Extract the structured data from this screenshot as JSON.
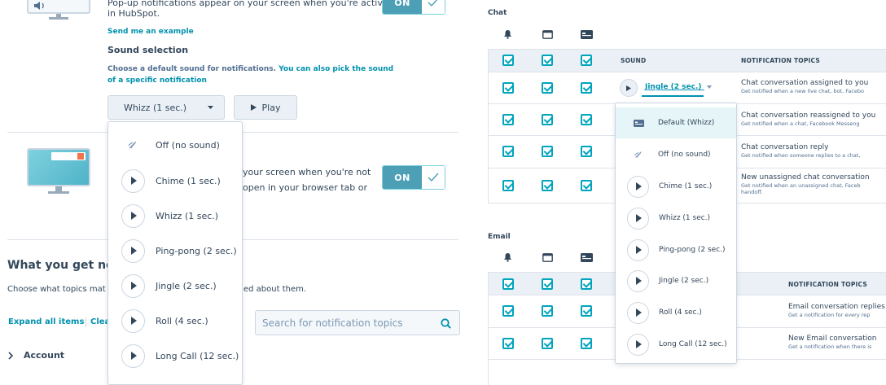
{
  "left": {
    "popup_desc_line1": "Pop-up notifications appear on your screen when you're active",
    "popup_desc_line2": "in HubSpot.",
    "send_example": "Send me an example",
    "toggle_on_label": "ON",
    "sound_selection_title": "Sound selection",
    "sound_help_line1_a": "Choose a default sound for notifications.",
    "sound_help_line1_b": "You can also pick the sound",
    "sound_help_line2": "of a specific notification",
    "sound_select_value": "Whizz (1 sec.)",
    "play_label": "Play",
    "browser_desc_line1": "your screen when you're not",
    "browser_desc_line2": "open in your browser tab or",
    "dropdown_options": [
      {
        "label": "Off (no sound)",
        "icon": "mute-icon"
      },
      {
        "label": "Chime (1 sec.)",
        "icon": "play-icon"
      },
      {
        "label": "Whizz (1 sec.)",
        "icon": "play-icon"
      },
      {
        "label": "Ping-pong (2 sec.)",
        "icon": "play-icon"
      },
      {
        "label": "Jingle (2 sec.)",
        "icon": "play-icon"
      },
      {
        "label": "Roll (4 sec.)",
        "icon": "play-icon"
      },
      {
        "label": "Long Call (12 sec.)",
        "icon": "play-icon"
      }
    ],
    "what_you_get": "What you get no",
    "choose_topics_a": "Choose what topics mat",
    "choose_topics_b": "ed about them.",
    "expand_all": "Expand all items",
    "clear": "Clea",
    "search_placeholder": "Search for notification topics",
    "account": "Account"
  },
  "right": {
    "chat_title": "Chat",
    "email_title": "Email",
    "col_sound": "SOUND",
    "col_topics": "NOTIFICATION TOPICS",
    "jingle_value": "Jingle (2 sec.)",
    "chat_topics": [
      {
        "title": "Chat conversation assigned to you",
        "sub": "Get notified when a new live chat, bot, Facebo"
      },
      {
        "title": "Chat conversation reassigned to you",
        "sub": "Get notified when a chat, Facebook Messeng"
      },
      {
        "title": "Chat conversation reply",
        "sub": "Get notified when someone replies to a chat,"
      },
      {
        "title": "New unassigned chat conversation",
        "sub": "Get notified when an unassigned chat, Faceb",
        "sub2": "handoff."
      }
    ],
    "email_topics": [
      {
        "title": "Email conversation replies",
        "sub": "Get a notification for every rep"
      },
      {
        "title": "New Email conversation",
        "sub": "Get a notification when there is"
      }
    ],
    "dropdown_options": [
      {
        "label": "Default (Whizz)",
        "icon": "default-sound-icon"
      },
      {
        "label": "Off (no sound)",
        "icon": "mute-icon"
      },
      {
        "label": "Chime (1 sec.)",
        "icon": "play-icon"
      },
      {
        "label": "Whizz (1 sec.)",
        "icon": "play-icon"
      },
      {
        "label": "Ping-pong (2 sec.)",
        "icon": "play-icon"
      },
      {
        "label": "Jingle (2 sec.)",
        "icon": "play-icon"
      },
      {
        "label": "Roll (4 sec.)",
        "icon": "play-icon"
      },
      {
        "label": "Long Call (12 sec.)",
        "icon": "play-icon"
      }
    ]
  },
  "colors": {
    "accent": "#00a4bd",
    "toggle_on": "#4d9fb6",
    "link": "#0091ae",
    "text": "#33475b",
    "border": "#cbd6e2",
    "header_bg": "#eaf0f6",
    "selected_bg": "#e5f5f8"
  }
}
